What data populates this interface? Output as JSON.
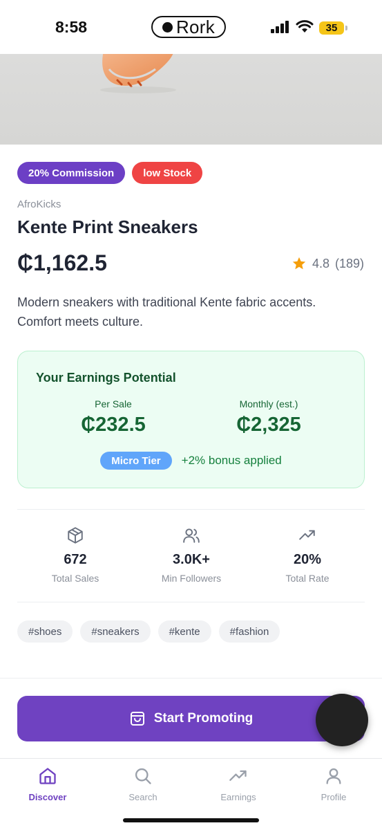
{
  "status_bar": {
    "time": "8:58",
    "island_label": "Rork",
    "battery": "35"
  },
  "product": {
    "badges": [
      "20% Commission",
      "low Stock"
    ],
    "brand": "AfroKicks",
    "title": "Kente Print Sneakers",
    "price": "₵1,162.5",
    "rating": "4.8",
    "reviews": "(189)",
    "description": "Modern sneakers with traditional Kente fabric accents. Comfort meets culture."
  },
  "earnings": {
    "title": "Your Earnings Potential",
    "per_sale_label": "Per Sale",
    "per_sale_value": "₵232.5",
    "monthly_label": "Monthly (est.)",
    "monthly_value": "₵2,325",
    "tier": "Micro Tier",
    "bonus": "+2% bonus applied"
  },
  "stats": [
    {
      "icon": "package-icon",
      "value": "672",
      "label": "Total Sales"
    },
    {
      "icon": "users-icon",
      "value": "3.0K+",
      "label": "Min Followers"
    },
    {
      "icon": "trending-up-icon",
      "value": "20%",
      "label": "Total Rate"
    }
  ],
  "tags": [
    "#shoes",
    "#sneakers",
    "#kente",
    "#fashion"
  ],
  "cta": {
    "label": "Start Promoting",
    "icon": "shopping-bag-icon"
  },
  "tabs": [
    {
      "label": "Discover",
      "icon": "home-icon",
      "active": true
    },
    {
      "label": "Search",
      "icon": "search-icon",
      "active": false
    },
    {
      "label": "Earnings",
      "icon": "trending-up-icon",
      "active": false
    },
    {
      "label": "Profile",
      "icon": "user-icon",
      "active": false
    }
  ],
  "colors": {
    "accent": "#6f42c1",
    "stock_badge": "#ef4444",
    "earnings_bg": "#ecfdf3",
    "earnings_text": "#166534",
    "tier_pill": "#60a5fa",
    "star": "#f59e0b"
  }
}
